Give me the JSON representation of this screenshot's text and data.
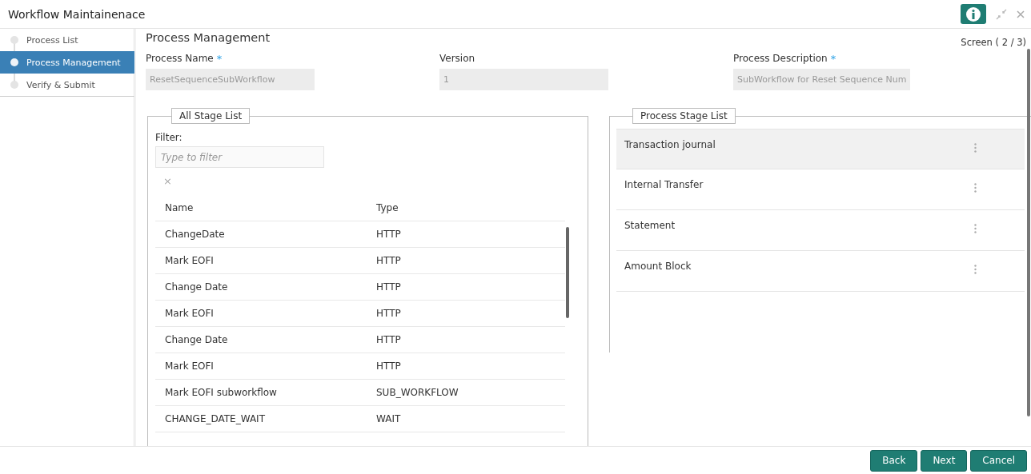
{
  "window": {
    "title": "Workflow Maintainenace"
  },
  "steps": [
    {
      "label": "Process List",
      "selected": false
    },
    {
      "label": "Process Management",
      "selected": true
    },
    {
      "label": "Verify & Submit",
      "selected": false
    }
  ],
  "page": {
    "title": "Process Management",
    "screen": "Screen ( 2 / 3)"
  },
  "fields": [
    {
      "label": "Process Name",
      "required_mark": "*",
      "value": "ResetSequenceSubWorkflow"
    },
    {
      "label": "Version",
      "value": "1"
    },
    {
      "label": "Process Description",
      "required_mark": "*",
      "value": "SubWorkflow for Reset Sequence Num"
    }
  ],
  "all_stage_list": {
    "legend": "All Stage List",
    "filter_label": "Filter:",
    "filter_placeholder": "Type to filter",
    "clear": "×",
    "columns": [
      "Name",
      "Type"
    ],
    "rows": [
      [
        "ChangeDate",
        "HTTP"
      ],
      [
        "Mark EOFI",
        "HTTP"
      ],
      [
        "Change Date",
        "HTTP"
      ],
      [
        "Mark EOFI",
        "HTTP"
      ],
      [
        "Change Date",
        "HTTP"
      ],
      [
        "Mark EOFI",
        "HTTP"
      ],
      [
        "Mark EOFI subworkflow",
        "SUB_WORKFLOW"
      ],
      [
        "CHANGE_DATE_WAIT",
        "WAIT"
      ]
    ]
  },
  "process_stage_list": {
    "legend": "Process Stage List",
    "items": [
      {
        "label": "Transaction journal",
        "selected": true
      },
      {
        "label": "Internal Transfer",
        "selected": false
      },
      {
        "label": "Statement",
        "selected": false
      },
      {
        "label": "Amount Block",
        "selected": false
      }
    ]
  },
  "buttons": [
    "Back",
    "Next",
    "Cancel"
  ]
}
